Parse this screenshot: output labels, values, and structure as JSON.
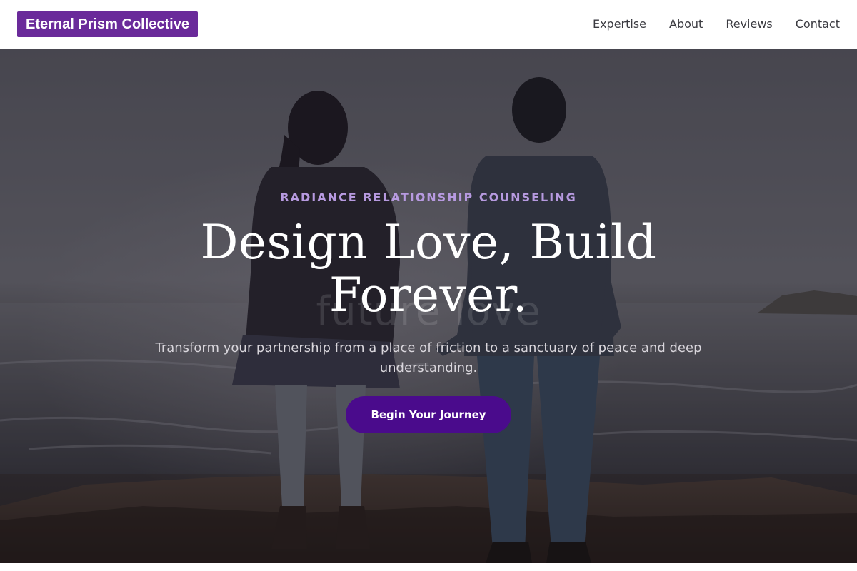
{
  "header": {
    "logo_text": "Eternal Prism Collective",
    "nav": [
      {
        "label": "Expertise"
      },
      {
        "label": "About"
      },
      {
        "label": "Reviews"
      },
      {
        "label": "Contact"
      }
    ]
  },
  "hero": {
    "kicker": "RADIANCE RELATIONSHIP COUNSELING",
    "headline": "Design Love, Build Forever.",
    "ghost_text": "future love",
    "subtitle": "Transform your partnership from a place of friction to a sanctuary of peace and deep understanding.",
    "cta_label": "Begin Your Journey"
  },
  "colors": {
    "brand": "#6a2a9a",
    "cta": "#4a0b8c",
    "kicker": "#b79ae0"
  }
}
